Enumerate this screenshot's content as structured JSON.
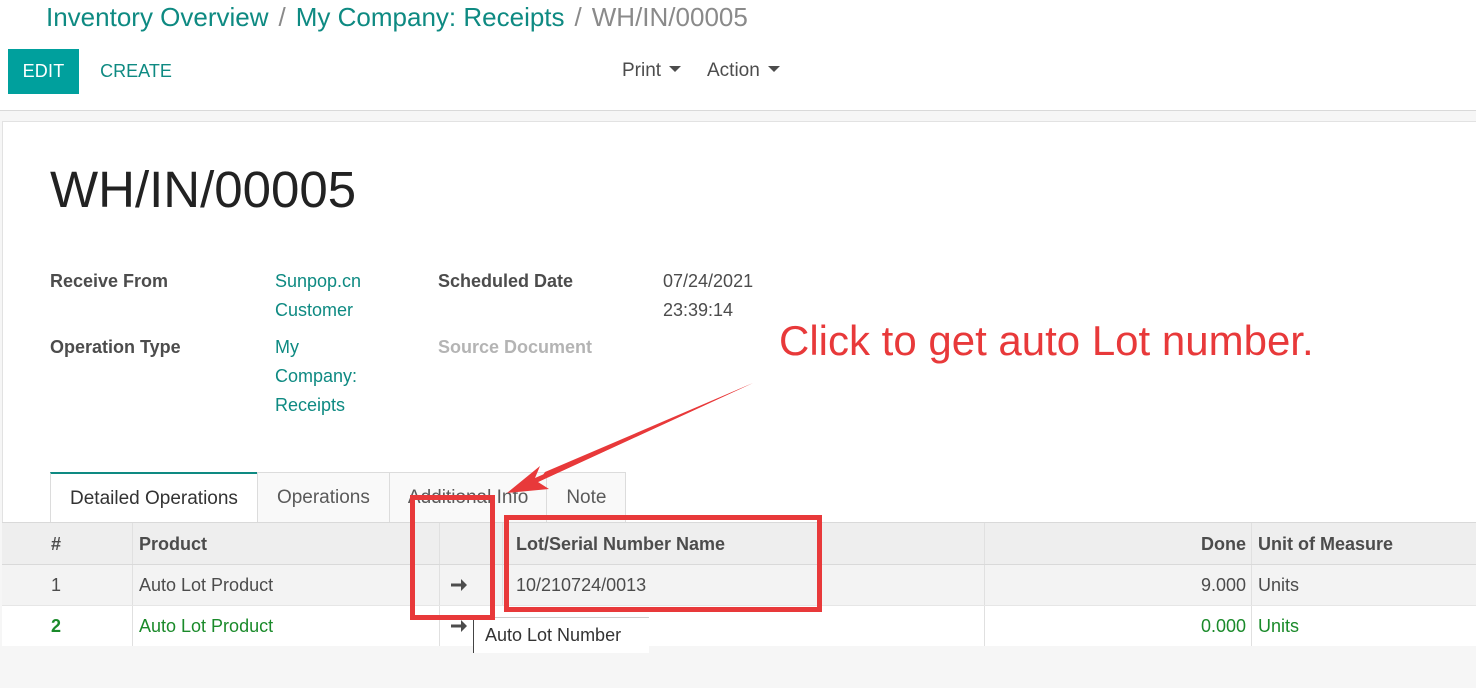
{
  "breadcrumb": {
    "items": [
      "Inventory Overview",
      "My Company: Receipts"
    ],
    "current": "WH/IN/00005",
    "separator": "/"
  },
  "toolbar": {
    "edit_label": "EDIT",
    "create_label": "CREATE",
    "print_label": "Print",
    "action_label": "Action"
  },
  "record": {
    "title": "WH/IN/00005",
    "receive_from_label": "Receive From",
    "receive_from_line1": "Sunpop.cn",
    "receive_from_line2": "Customer",
    "operation_type_label": "Operation Type",
    "operation_type_line1": "My",
    "operation_type_line2": "Company:",
    "operation_type_line3": "Receipts",
    "scheduled_date_label": "Scheduled Date",
    "scheduled_date_line1": "07/24/2021",
    "scheduled_date_line2": "23:39:14",
    "source_document_label": "Source Document"
  },
  "tabs": [
    {
      "label": "Detailed Operations",
      "active": true
    },
    {
      "label": "Operations",
      "active": false
    },
    {
      "label": "Additional Info",
      "active": false
    },
    {
      "label": "Note",
      "active": false
    }
  ],
  "table": {
    "headers": {
      "num": "#",
      "product": "Product",
      "lot": "Lot/Serial Number Name",
      "done": "Done",
      "uom": "Unit of Measure"
    },
    "rows": [
      {
        "num": "1",
        "product": "Auto Lot Product",
        "lot": "10/210724/0013",
        "done": "9.000",
        "uom": "Units"
      },
      {
        "num": "2",
        "product": "Auto Lot Product",
        "lot": "",
        "done": "0.000",
        "uom": "Units"
      }
    ]
  },
  "tooltip": "Auto Lot Number",
  "annotation": {
    "text": "Click to get auto Lot number."
  },
  "colors": {
    "primary": "#00a09d",
    "link": "#0e8a82",
    "annotation": "#e8393a",
    "row_done": "#1a8a2a"
  },
  "icons": {
    "row_action": "arrow-right-icon",
    "dropdown": "caret-down-icon"
  }
}
